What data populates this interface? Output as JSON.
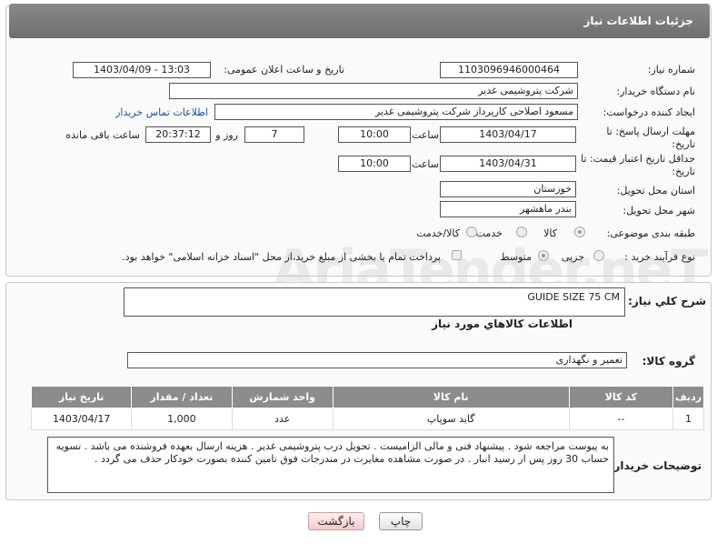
{
  "header": {
    "title": "جزئیات اطلاعات نیاز"
  },
  "form": {
    "need_number_label": "شماره نیاز:",
    "need_number": "1103096946000464",
    "announce_label": "تاریخ و ساعت اعلان عمومی:",
    "announce_value": "1403/04/09 - 13:03",
    "buyer_org_label": "نام دستگاه خریدار:",
    "buyer_org": "شرکت پتروشیمی غدیر",
    "requester_label": "ایجاد کننده درخواست:",
    "requester": "مسعود اصلاحی کارپرداز شرکت پتروشیمی غدیر",
    "contact_link": "اطلاعات تماس خریدار",
    "reply_deadline_label": "مهلت ارسال پاسخ: تا تاریخ:",
    "reply_date": "1403/04/17",
    "time_label": "ساعت",
    "reply_time": "10:00",
    "days_value": "7",
    "days_label": "روز و",
    "remaining_time": "20:37:12",
    "remaining_label": "ساعت باقی مانده",
    "validity_label": "حداقل تاریخ اعتبار قیمت: تا تاریخ:",
    "validity_date": "1403/04/31",
    "validity_time": "10:00",
    "province_label": "استان محل تحویل:",
    "province": "خوزستان",
    "city_label": "شهر محل تحویل:",
    "city": "بندر ماهشهر",
    "category_label": "طبقه بندی موضوعی:",
    "category_options": [
      "کالا",
      "خدمت",
      "کالا/خدمت"
    ],
    "purchase_type_label": "نوع فرآیند خرید :",
    "purchase_options": [
      "جزیی",
      "متوسط"
    ],
    "payment_note": "پرداخت تمام یا بخشی از مبلغ خرید،از محل \"اسناد خزانه اسلامی\" خواهد بود."
  },
  "summary": {
    "label": "شرح کلي نياز:",
    "value": "GUIDE SIZE 75 CM",
    "items_title": "اطلاعات کالاهاي مورد نياز",
    "group_label": "گروه کالا:",
    "group_value": "تعمیر و نگهداری"
  },
  "table": {
    "headers": [
      "ردیف",
      "کد کالا",
      "نام کالا",
      "واحد شمارش",
      "تعداد / مقدار",
      "تاریخ نیاز"
    ],
    "rows": [
      {
        "row": "1",
        "code": "--",
        "name": "گاید سوپاپ",
        "unit": "عدد",
        "qty": "1,000",
        "date": "1403/04/17"
      }
    ]
  },
  "notes": {
    "label": "توضیحات خریدار:",
    "value": "به پیوست مراجعه شود . پیشنهاد فنی و مالی الزامیست . تحویل درب پتروشیمی غدیر . هزینه ارسال بعهده فروشنده می باشد . تسویه حساب 30 روز پس از رسید انبار .  در صورت مشاهده مغایرت در مندرجات فوق تامین کننده بصورت خودکار حذف می گردد ."
  },
  "buttons": {
    "print": "چاپ",
    "back": "بازگشت"
  },
  "watermark": "AriaTender.neT"
}
